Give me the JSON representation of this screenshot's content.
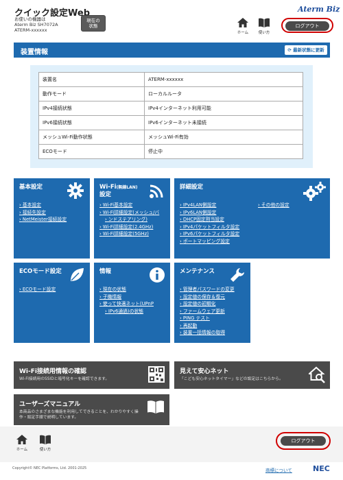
{
  "header": {
    "title": "クイック設定Web",
    "device_line1": "お使いの機器は",
    "device_line2": "Aterm Biz SH7072A",
    "device_line3": "ATERM-xxxxxx",
    "status_button_line1": "現在の",
    "status_button_line2": "状態",
    "home_label": "ホーム",
    "howto_label": "使い方",
    "brand": "Aterm Biz",
    "logout_label": "ログアウト"
  },
  "device_info": {
    "section_title": "装置情報",
    "refresh_label": "最新状態に更新",
    "rows": [
      {
        "key": "装置名",
        "value": "ATERM-xxxxxx"
      },
      {
        "key": "動作モード",
        "value": "ローカルルータ"
      },
      {
        "key": "IPv4接続状態",
        "value": "IPv4インターネット利用可能"
      },
      {
        "key": "IPv6接続状態",
        "value": "IPv6インターネット未接続"
      },
      {
        "key": "メッシュWi-Fi動作状態",
        "value": "メッシュWi-Fi有効"
      },
      {
        "key": "ECOモード",
        "value": "停止中"
      }
    ]
  },
  "tiles": {
    "basic": {
      "title": "基本設定",
      "items": [
        "基本設定",
        "接続先設定",
        "NetMeister接続設定"
      ]
    },
    "wifi": {
      "title_main": "Wi-Fi",
      "title_sub": "(無線LAN)",
      "title_line2": "設定",
      "items": [
        "Wi-Fi基本設定",
        "Wi-Fi詳細設定(メッシュ/バ",
        "ンドステアリング)",
        "Wi-Fi詳細設定(2.4GHz)",
        "Wi-Fi詳細設定(5GHz)"
      ]
    },
    "advanced": {
      "title": "詳細設定",
      "items": [
        "IPv4LAN側設定",
        "IPv6LAN側設定",
        "DHCP固定割当設定",
        "IPv4パケットフィルタ設定",
        "IPv6パケットフィルタ設定",
        "ポートマッピング設定"
      ],
      "other": "その他の設定"
    },
    "eco": {
      "title": "ECOモード設定",
      "items": [
        "ECOモード設定"
      ]
    },
    "info": {
      "title": "情報",
      "items": [
        "現在の状態",
        "子機情報",
        "使って快適ネット(UPnP",
        "IPv6通過)の状態"
      ]
    },
    "maintenance": {
      "title": "メンテナンス",
      "items": [
        "管理者パスワードの変更",
        "設定値の保存＆復元",
        "設定値の初期化",
        "ファームウェア更新",
        "PING テスト",
        "再起動",
        "装置一括情報の取得"
      ]
    }
  },
  "bars": {
    "wifi_check": {
      "title": "Wi-Fi接続用情報の確認",
      "desc": "Wi-Fi接続用のSSIDと暗号化キーを確認できます。"
    },
    "safe_net": {
      "title": "見えて安心ネット",
      "desc": "「こども安心ネットタイマー」などの設定はこちらから。"
    },
    "manual": {
      "title": "ユーザーズマニュアル",
      "desc1": "本商品のさまざまな機能を利用してできることを、わかりやすく操",
      "desc2": "作・設定手順で説明しています。"
    }
  },
  "footer": {
    "home_label": "ホーム",
    "howto_label": "使い方",
    "logout_label": "ログアウト",
    "copyright": "Copyright© NEC Platforms, Ltd. 2001-2025",
    "trademark": "商標について",
    "nec": "NEC"
  },
  "colors": {
    "tile_blue": "#1e6aaf",
    "panel_light": "#e0f0fb",
    "bar_gray": "#4a4a4a",
    "highlight_red": "#d00000"
  }
}
